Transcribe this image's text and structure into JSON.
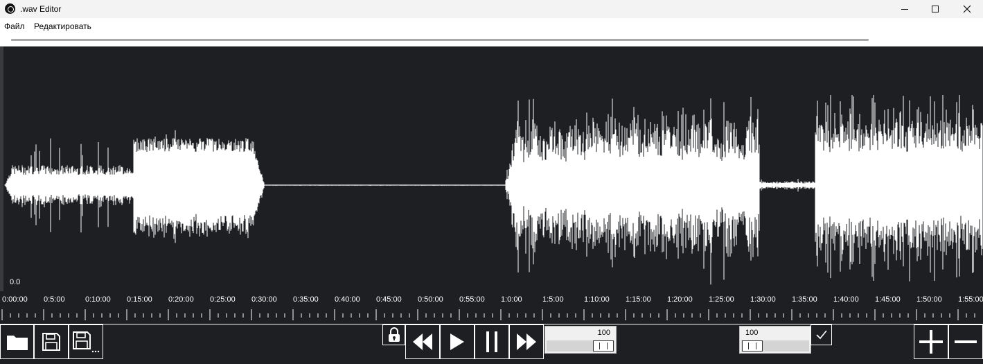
{
  "window": {
    "title": ".wav Editor",
    "icons": {
      "app": "music-disc-icon",
      "minimize": "minimize-icon",
      "maximize": "maximize-icon",
      "close": "close-icon"
    }
  },
  "menu": {
    "file": "Файл",
    "edit": "Редактировать"
  },
  "progress": {
    "fraction": 0.0
  },
  "waveform": {
    "zero_label": "0.0",
    "color": "#ffffff",
    "background": "#1e1f22"
  },
  "timeline": {
    "labels": [
      "0:00:00",
      "0:5:00",
      "0:10:00",
      "0:15:00",
      "0:20:00",
      "0:25:00",
      "0:30:00",
      "0:35:00",
      "0:40:00",
      "0:45:00",
      "0:50:00",
      "0:55:00",
      "1:0:00",
      "1:5:00",
      "1:10:00",
      "1:15:00",
      "1:20:00",
      "1:25:00",
      "1:30:00",
      "1:35:00",
      "1:40:00",
      "1:45:00",
      "1:50:00",
      "1:55:00"
    ]
  },
  "toolbar": {
    "icons": {
      "open": "folder-icon",
      "save": "floppy-disk-icon",
      "save_as": "floppy-disk-ellipsis-icon",
      "lock": "lock-icon",
      "rewind": "rewind-icon",
      "play": "play-icon",
      "pause": "pause-icon",
      "forward": "fast-forward-icon",
      "apply": "checkmark-icon",
      "zoom_in": "plus-icon",
      "zoom_out": "minus-icon"
    },
    "volume_value": "100",
    "volume_level": 1.0,
    "speed_value": "100",
    "speed_level": 0.0
  }
}
